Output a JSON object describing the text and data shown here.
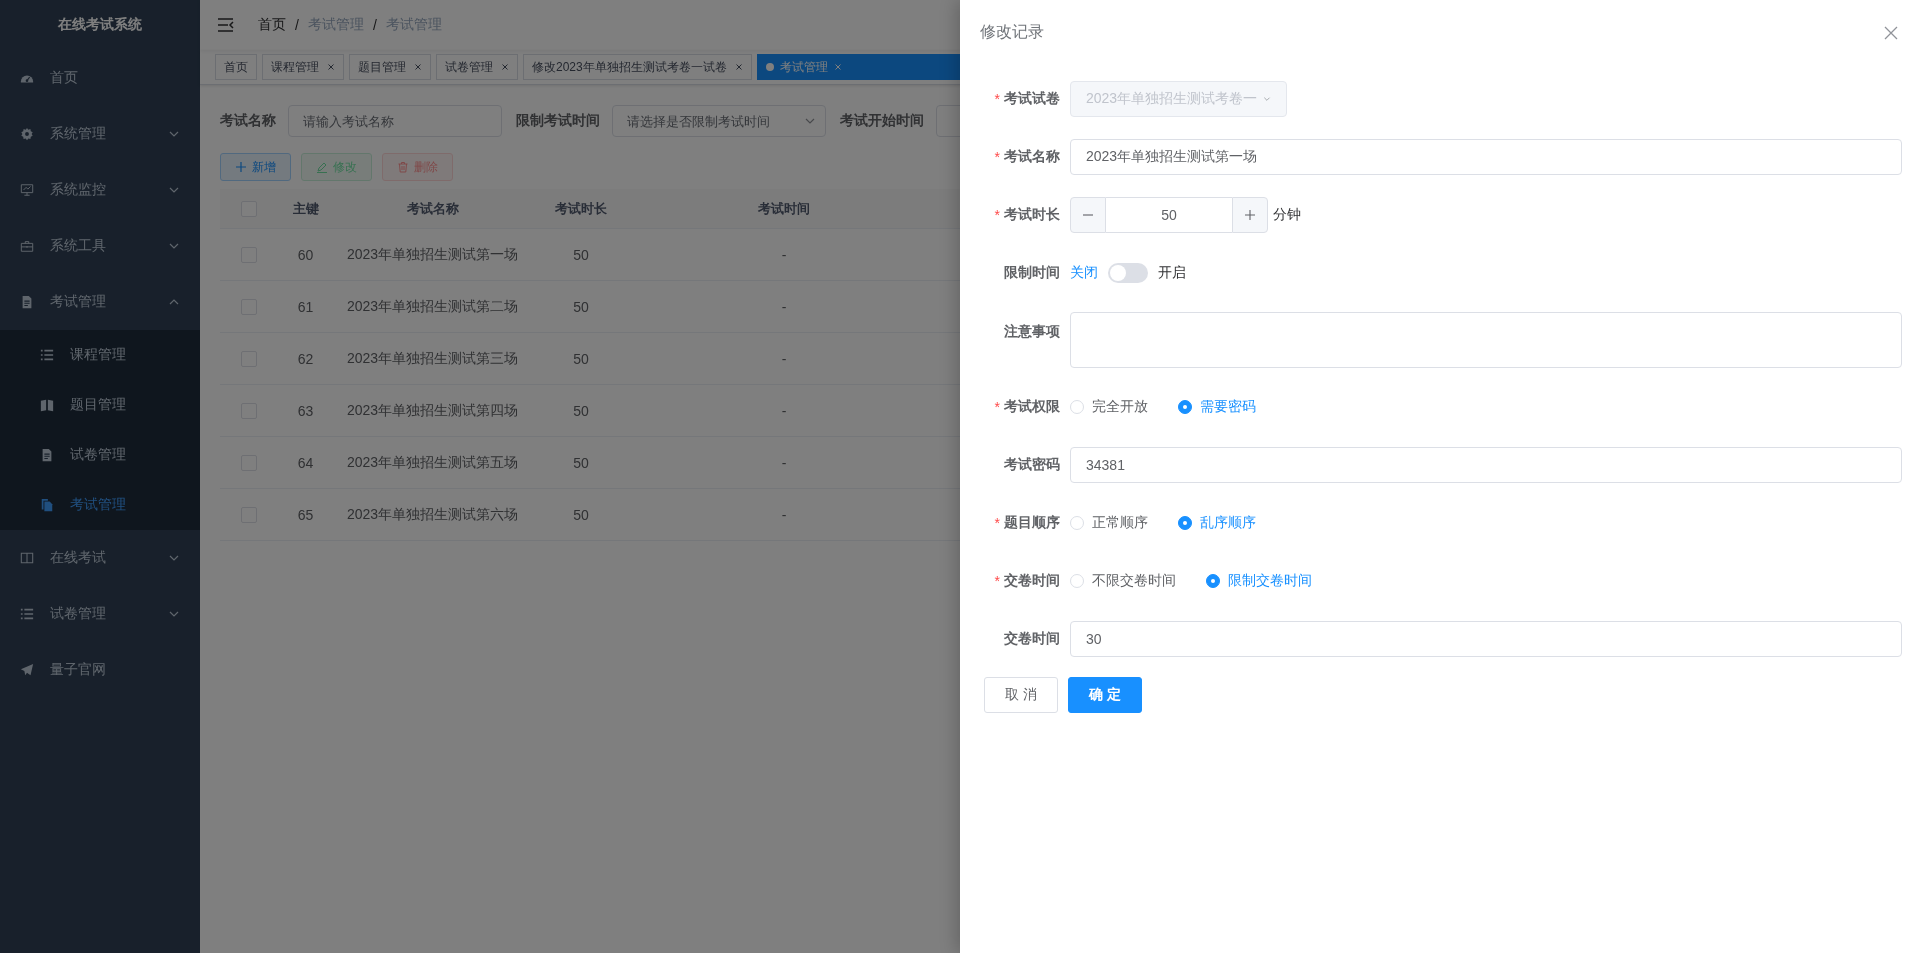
{
  "sidebar": {
    "title": "在线考试系统",
    "items": [
      {
        "label": "首页"
      },
      {
        "label": "系统管理",
        "expanded": false
      },
      {
        "label": "系统监控",
        "expanded": false
      },
      {
        "label": "系统工具",
        "expanded": false
      },
      {
        "label": "考试管理",
        "expanded": true,
        "children": [
          {
            "label": "课程管理",
            "selected": false
          },
          {
            "label": "题目管理",
            "selected": false
          },
          {
            "label": "试卷管理",
            "selected": false
          },
          {
            "label": "考试管理",
            "selected": true
          }
        ]
      },
      {
        "label": "在线考试",
        "expanded": false
      },
      {
        "label": "试卷管理",
        "expanded": false
      },
      {
        "label": "量子官网"
      }
    ]
  },
  "breadcrumb": [
    "首页",
    "考试管理",
    "考试管理"
  ],
  "breadcrumb_separator": "/",
  "tags": [
    {
      "label": "首页",
      "closable": false,
      "selected": false
    },
    {
      "label": "课程管理",
      "closable": true,
      "selected": false
    },
    {
      "label": "题目管理",
      "closable": true,
      "selected": false
    },
    {
      "label": "试卷管理",
      "closable": true,
      "selected": false
    },
    {
      "label": "修改2023年单独招生测试考卷一试卷",
      "closable": true,
      "selected": false
    },
    {
      "label": "考试管理",
      "closable": true,
      "selected": true
    }
  ],
  "filters": [
    {
      "label": "考试名称",
      "kind": "input",
      "placeholder": "请输入考试名称"
    },
    {
      "label": "限制考试时间",
      "kind": "select",
      "placeholder": "请选择是否限制考试时间"
    },
    {
      "label": "考试开始时间",
      "kind": "date"
    }
  ],
  "toolbar": [
    {
      "label": "新增",
      "kind": "primary",
      "disabled": false
    },
    {
      "label": "修改",
      "kind": "success",
      "disabled": true
    },
    {
      "label": "删除",
      "kind": "danger",
      "disabled": true
    }
  ],
  "table": {
    "header_checked": false,
    "columns": [
      "主键",
      "考试名称",
      "考试时长",
      "考试时间"
    ],
    "rows": [
      {
        "checked": false,
        "cells": [
          "60",
          "2023年单独招生测试第一场",
          "50",
          "-"
        ]
      },
      {
        "checked": false,
        "cells": [
          "61",
          "2023年单独招生测试第二场",
          "50",
          "-"
        ]
      },
      {
        "checked": false,
        "cells": [
          "62",
          "2023年单独招生测试第三场",
          "50",
          "-"
        ]
      },
      {
        "checked": false,
        "cells": [
          "63",
          "2023年单独招生测试第四场",
          "50",
          "-"
        ]
      },
      {
        "checked": false,
        "cells": [
          "64",
          "2023年单独招生测试第五场",
          "50",
          "-"
        ]
      },
      {
        "checked": false,
        "cells": [
          "65",
          "2023年单独招生测试第六场",
          "50",
          "-"
        ]
      }
    ]
  },
  "drawer": {
    "title": "修改记录",
    "required_mark": "*",
    "fields": [
      {
        "kind": "select",
        "label": "考试试卷",
        "required": true,
        "disabled": true,
        "value": "2023年单独招生测试考卷一"
      },
      {
        "kind": "input",
        "label": "考试名称",
        "required": true,
        "value": "2023年单独招生测试第一场"
      },
      {
        "kind": "number",
        "label": "考试时长",
        "required": true,
        "value": "50",
        "unit": "分钟"
      },
      {
        "kind": "switch",
        "label": "限制时间",
        "required": false,
        "off_label": "关闭",
        "on_label": "开启",
        "on": false
      },
      {
        "kind": "textarea",
        "label": "注意事项",
        "required": false
      },
      {
        "kind": "radio",
        "label": "考试权限",
        "required": true,
        "options": [
          {
            "label": "完全开放",
            "selected": false
          },
          {
            "label": "需要密码",
            "selected": true
          }
        ]
      },
      {
        "kind": "input",
        "label": "考试密码",
        "required": false,
        "value": "34381"
      },
      {
        "kind": "radio",
        "label": "题目顺序",
        "required": true,
        "options": [
          {
            "label": "正常顺序",
            "selected": false
          },
          {
            "label": "乱序顺序",
            "selected": true
          }
        ]
      },
      {
        "kind": "radio",
        "label": "交卷时间",
        "required": true,
        "options": [
          {
            "label": "不限交卷时间",
            "selected": false
          },
          {
            "label": "限制交卷时间",
            "selected": true
          }
        ]
      },
      {
        "kind": "input",
        "label": "交卷时间",
        "required": false,
        "value": "30"
      }
    ],
    "buttons": [
      {
        "label": "取 消",
        "kind": "default"
      },
      {
        "label": "确 定",
        "kind": "primary"
      }
    ]
  }
}
